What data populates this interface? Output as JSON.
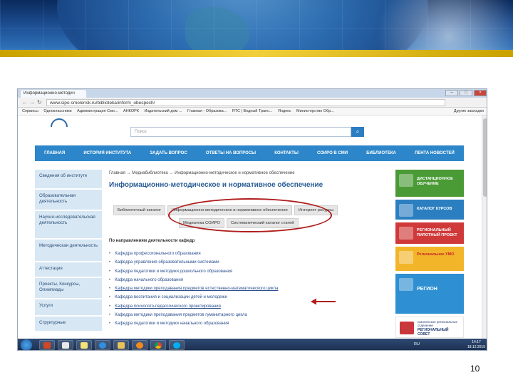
{
  "browser": {
    "tab_title": "Информационно-методич",
    "url": "www.sipo-smolensk.ru/biblioteka/inform_obespech/",
    "bookmarks": [
      "Сервисы",
      "Одноклассники",
      "Администрация Смо...",
      "АНКОРК",
      "Издательский дом ...",
      "Главная - Образова...",
      "RTC | Водный Транс...",
      "Яндекс",
      "Министерство Обр..."
    ],
    "other_bookmarks": "Другие закладки"
  },
  "site": {
    "search_placeholder": "Поиск",
    "nav": [
      "ГЛАВНАЯ",
      "ИСТОРИЯ ИНСТИТУТА",
      "ЗАДАТЬ ВОПРОС",
      "ОТВЕТЫ НА ВОПРОСЫ",
      "КОНТАКТЫ",
      "СОИРО В СМИ",
      "БИБЛИОТЕКА",
      "ЛЕНТА НОВОСТЕЙ"
    ],
    "sidebar": [
      "Сведения об институте",
      "Образовательная деятельность",
      "Научно-исследовательская деятельность",
      "Методическая деятельность",
      "Аттестация",
      "Проекты, Конкурсы, Олимпиады",
      "Услуги",
      "Структурные"
    ],
    "breadcrumbs": "Главная  →  Медиабиблиотека  →  Информационно-методическое и нормативное обеспечение",
    "page_title": "Информационно-методическое и нормативное обеспечение",
    "tabs_row1": [
      "Библиотечный каталог",
      "Информационно-методическое и нормативное обеспечение",
      "Интернет ресурсы"
    ],
    "tabs_row2": [
      "Медиатека СОИРО",
      "Систематический каталог статей"
    ],
    "subheading": "По направлениям деятельности кафедр",
    "departments": [
      "Кафедра профессионального образования",
      "Кафедра управления образовательными системами",
      "Кафедра педагогики и методики дошкольного образования",
      "Кафедра начального образования",
      "Кафедра методики преподавания предметов естественно-математического цикла",
      "Кафедра воспитания и социализации детей и молодежи",
      "Кафедра психолого-педагогического проектирования",
      "Кафедра методики преподавания предметов гуманитарного цикла",
      "Кафедра педагогики и методики начального образования"
    ],
    "right_banners": {
      "distance": "ДИСТАНЦИОННОЕ ОБУЧЕНИЕ",
      "catalog": "КАТАЛОГ КУРСОВ",
      "pilot": "РЕГИОНАЛЬНЫЙ ПИЛОТНЫЙ ПРОЕКТ",
      "umo": "Региональное УМО",
      "region": "РЕГИОН",
      "council_line1": "Смоленское региональное отделение",
      "council_line2": "РЕГИОНАЛЬНЫЙ СОВЕТ"
    }
  },
  "taskbar": {
    "language": "RU",
    "time": "14:17",
    "date": "18.12.2015"
  },
  "slide": {
    "page_number": "10"
  },
  "colors": {
    "nav_blue": "#2c86c9",
    "title_blue": "#2a5d94",
    "annotation_red": "#b01e1e"
  }
}
